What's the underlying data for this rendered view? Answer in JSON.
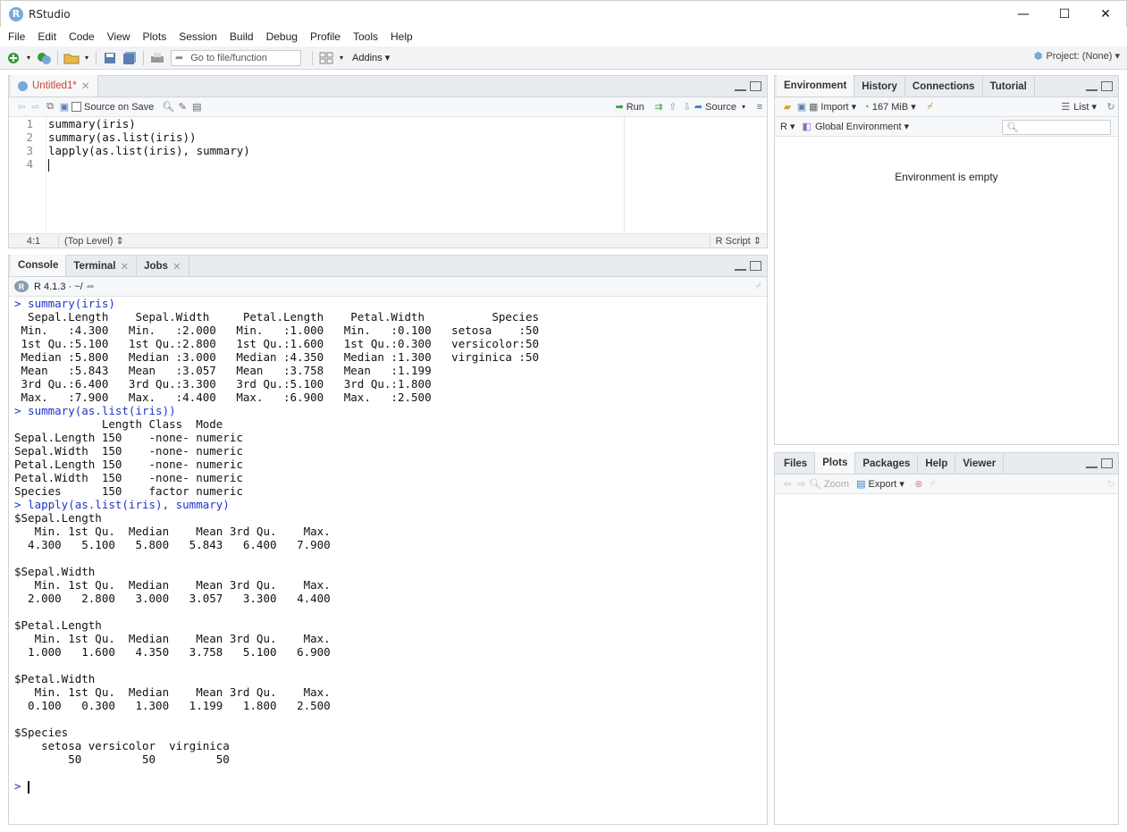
{
  "window": {
    "title": "RStudio",
    "logo_letter": "R",
    "minimize": "—",
    "maximize": "☐",
    "close": "✕"
  },
  "menu": [
    "File",
    "Edit",
    "Code",
    "View",
    "Plots",
    "Session",
    "Build",
    "Debug",
    "Profile",
    "Tools",
    "Help"
  ],
  "toolbar": {
    "goto_placeholder": "Go to file/function",
    "addins": "Addins ▾",
    "project": "Project: (None) ▾"
  },
  "editor": {
    "tab_label": "Untitled1*",
    "source_on_save": "Source on Save",
    "run_label": "Run",
    "source_label": "Source",
    "lines": [
      "1",
      "2",
      "3",
      "4"
    ],
    "code": [
      "summary(iris)",
      "summary(as.list(iris))",
      "lapply(as.list(iris), summary)",
      ""
    ],
    "position": "4:1",
    "scope": "(Top Level) ⇕",
    "filetype": "R Script ⇕"
  },
  "console": {
    "tabs": [
      "Console",
      "Terminal",
      "Jobs"
    ],
    "r_version": "R 4.1.3 · ~/",
    "output": [
      {
        "t": "cmd",
        "s": "> summary(iris)"
      },
      {
        "t": "out",
        "s": "  Sepal.Length    Sepal.Width     Petal.Length    Petal.Width          Species  "
      },
      {
        "t": "out",
        "s": " Min.   :4.300   Min.   :2.000   Min.   :1.000   Min.   :0.100   setosa    :50  "
      },
      {
        "t": "out",
        "s": " 1st Qu.:5.100   1st Qu.:2.800   1st Qu.:1.600   1st Qu.:0.300   versicolor:50  "
      },
      {
        "t": "out",
        "s": " Median :5.800   Median :3.000   Median :4.350   Median :1.300   virginica :50  "
      },
      {
        "t": "out",
        "s": " Mean   :5.843   Mean   :3.057   Mean   :3.758   Mean   :1.199                  "
      },
      {
        "t": "out",
        "s": " 3rd Qu.:6.400   3rd Qu.:3.300   3rd Qu.:5.100   3rd Qu.:1.800                  "
      },
      {
        "t": "out",
        "s": " Max.   :7.900   Max.   :4.400   Max.   :6.900   Max.   :2.500                  "
      },
      {
        "t": "cmd",
        "s": "> summary(as.list(iris))"
      },
      {
        "t": "out",
        "s": "             Length Class  Mode   "
      },
      {
        "t": "out",
        "s": "Sepal.Length 150    -none- numeric"
      },
      {
        "t": "out",
        "s": "Sepal.Width  150    -none- numeric"
      },
      {
        "t": "out",
        "s": "Petal.Length 150    -none- numeric"
      },
      {
        "t": "out",
        "s": "Petal.Width  150    -none- numeric"
      },
      {
        "t": "out",
        "s": "Species      150    factor numeric"
      },
      {
        "t": "cmd",
        "s": "> lapply(as.list(iris), summary)"
      },
      {
        "t": "out",
        "s": "$Sepal.Length"
      },
      {
        "t": "out",
        "s": "   Min. 1st Qu.  Median    Mean 3rd Qu.    Max. "
      },
      {
        "t": "out",
        "s": "  4.300   5.100   5.800   5.843   6.400   7.900 "
      },
      {
        "t": "out",
        "s": ""
      },
      {
        "t": "out",
        "s": "$Sepal.Width"
      },
      {
        "t": "out",
        "s": "   Min. 1st Qu.  Median    Mean 3rd Qu.    Max. "
      },
      {
        "t": "out",
        "s": "  2.000   2.800   3.000   3.057   3.300   4.400 "
      },
      {
        "t": "out",
        "s": ""
      },
      {
        "t": "out",
        "s": "$Petal.Length"
      },
      {
        "t": "out",
        "s": "   Min. 1st Qu.  Median    Mean 3rd Qu.    Max. "
      },
      {
        "t": "out",
        "s": "  1.000   1.600   4.350   3.758   5.100   6.900 "
      },
      {
        "t": "out",
        "s": ""
      },
      {
        "t": "out",
        "s": "$Petal.Width"
      },
      {
        "t": "out",
        "s": "   Min. 1st Qu.  Median    Mean 3rd Qu.    Max. "
      },
      {
        "t": "out",
        "s": "  0.100   0.300   1.300   1.199   1.800   2.500 "
      },
      {
        "t": "out",
        "s": ""
      },
      {
        "t": "out",
        "s": "$Species"
      },
      {
        "t": "out",
        "s": "    setosa versicolor  virginica "
      },
      {
        "t": "out",
        "s": "        50         50         50 "
      },
      {
        "t": "out",
        "s": ""
      }
    ],
    "prompt": "> "
  },
  "environment": {
    "tabs": [
      "Environment",
      "History",
      "Connections",
      "Tutorial"
    ],
    "import": "Import ▾",
    "memory": "167 MiB ▾",
    "view": "List ▾",
    "lang": "R ▾",
    "scope": "Global Environment ▾",
    "empty_message": "Environment is empty"
  },
  "files": {
    "tabs": [
      "Files",
      "Plots",
      "Packages",
      "Help",
      "Viewer"
    ],
    "zoom": "Zoom",
    "export": "Export ▾"
  }
}
